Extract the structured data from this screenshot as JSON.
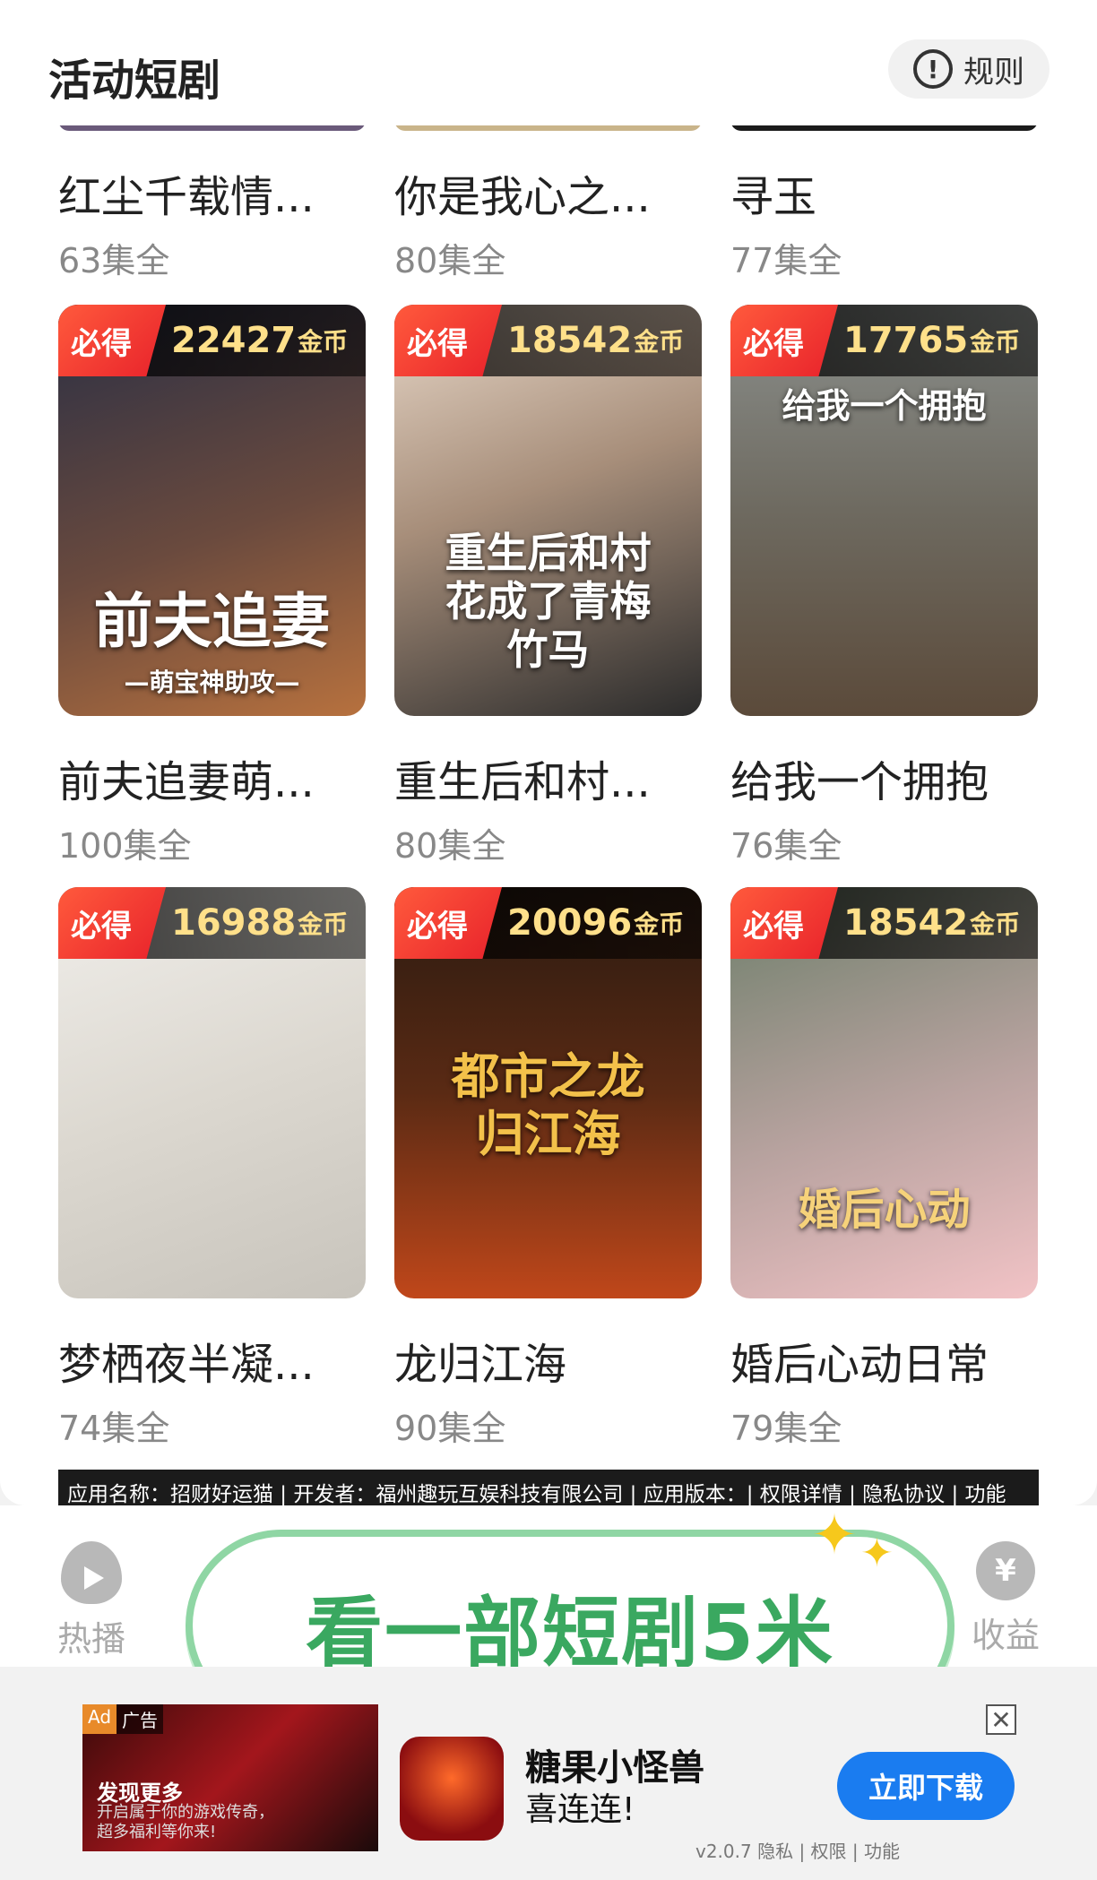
{
  "header": {
    "title": "活动短剧",
    "rules_label": "规则"
  },
  "top_row": [
    {
      "name": "红尘千载情...",
      "episodes": "63集全"
    },
    {
      "name": "你是我心之...",
      "episodes": "80集全"
    },
    {
      "name": "寻玉",
      "episodes": "77集全"
    }
  ],
  "badge_prefix": "必得",
  "coin_unit": "金币",
  "dramas": [
    {
      "name": "前夫追妻萌...",
      "episodes": "100集全",
      "coins": "22427",
      "poster_title": "前夫追妻",
      "poster_sub": "—萌宝神助攻—",
      "c1": "#2a2f44",
      "c2": "#b7713e"
    },
    {
      "name": "重生后和村...",
      "episodes": "80集全",
      "coins": "18542",
      "poster_title": "重生后和村花成了青梅竹马",
      "poster_sub": "",
      "c1": "#e7d7c8",
      "c2": "#2b2b2b"
    },
    {
      "name": "给我一个拥抱",
      "episodes": "76集全",
      "coins": "17765",
      "poster_title": "给我一个拥抱",
      "poster_sub": "",
      "c1": "#8b8f8c",
      "c2": "#5b4a3a"
    },
    {
      "name": "梦栖夜半凝...",
      "episodes": "74集全",
      "coins": "16988",
      "poster_title": "",
      "poster_sub": "",
      "c1": "#f0eeea",
      "c2": "#c8c4bc"
    },
    {
      "name": "龙归江海",
      "episodes": "90集全",
      "coins": "20096",
      "poster_title": "都市之龙归江海",
      "poster_sub": "",
      "c1": "#2a1a10",
      "c2": "#c0471a"
    },
    {
      "name": "婚后心动日常",
      "episodes": "79集全",
      "coins": "18542",
      "poster_title": "婚后心动",
      "poster_sub": "",
      "c1": "#6d7e6a",
      "c2": "#f2c3c6"
    }
  ],
  "disclaimer": "应用名称：招财好运猫 | 开发者：福州趣玩互娱科技有限公司 | 应用版本：| 权限详情 | 隐私协议 | 功能",
  "nav": {
    "left_label": "热播",
    "right_label": "收益"
  },
  "bubble": {
    "text": "看一部短剧5米"
  },
  "ad": {
    "tag_ad": "Ad",
    "tag_label": "广告",
    "img_title": "发现更多",
    "img_sub": "开启属于你的游戏传奇，超多福利等你来!",
    "app_name": "糖果小怪兽",
    "app_desc": "喜连连!",
    "download": "立即下载",
    "meta": "v2.0.7 隐私 | 权限 | 功能",
    "close": "✕"
  },
  "colors": {
    "accent_green": "#3aa860",
    "badge_red": "#e8222b",
    "coin_gold": "#ffe08a",
    "download_blue": "#1a7cf0"
  }
}
